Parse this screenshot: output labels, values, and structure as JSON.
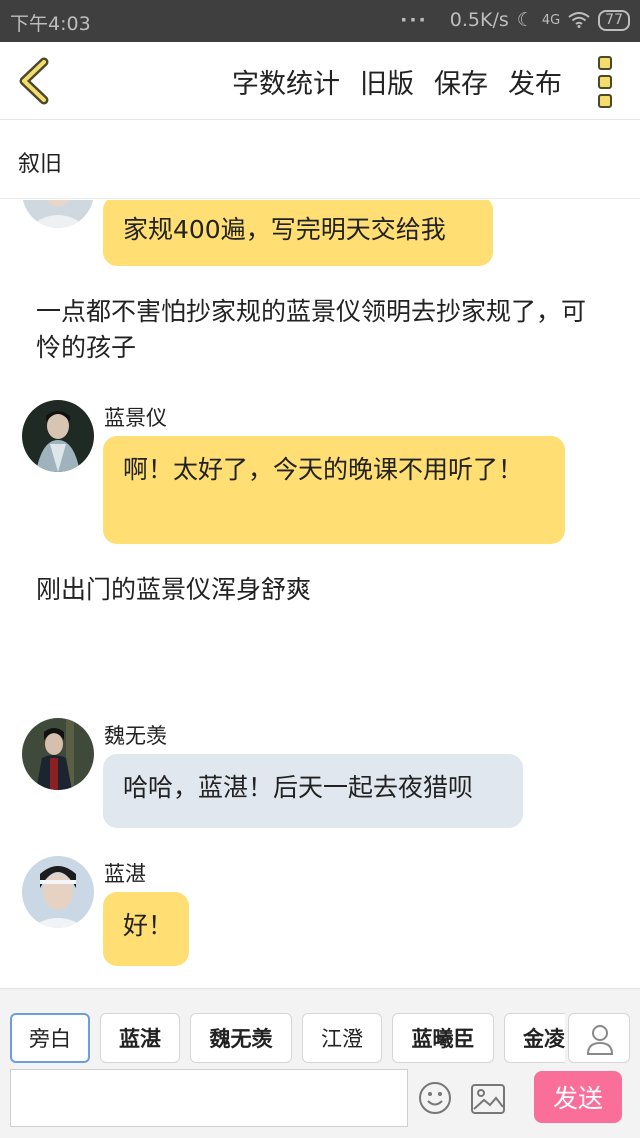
{
  "status_bar": {
    "time": "下午4:03",
    "network_speed": "0.5K/s",
    "signal": "4G",
    "battery": "77"
  },
  "toolbar": {
    "word_count": "字数统计",
    "old_version": "旧版",
    "save": "保存",
    "publish": "发布"
  },
  "chapter_title": "叙旧",
  "messages": [
    {
      "type": "dialogue",
      "speaker": "",
      "text": "家规400遍，写完明天交给我",
      "color": "#ffde73"
    },
    {
      "type": "narration",
      "text": "一点都不害怕抄家规的蓝景仪领明去抄家规了，可怜的孩子"
    },
    {
      "type": "dialogue",
      "speaker": "蓝景仪",
      "text": "啊！太好了，今天的晚课不用听了！",
      "color": "#ffde73"
    },
    {
      "type": "narration",
      "text": "刚出门的蓝景仪浑身舒爽"
    },
    {
      "type": "dialogue",
      "speaker": "魏无羡",
      "text": "哈哈，蓝湛！后天一起去夜猎呗",
      "color": "#e1e7ee"
    },
    {
      "type": "dialogue",
      "speaker": "蓝湛",
      "text": "好！",
      "color": "#ffde73"
    }
  ],
  "characters": [
    "旁白",
    "蓝湛",
    "魏无羡",
    "江澄",
    "蓝曦臣",
    "金凌"
  ],
  "composer": {
    "placeholder": "",
    "send_label": "发送"
  },
  "colors": {
    "accent_yellow": "#ffde73",
    "send_pink": "#f96f9a",
    "chip_active_border": "#6b9de0"
  }
}
